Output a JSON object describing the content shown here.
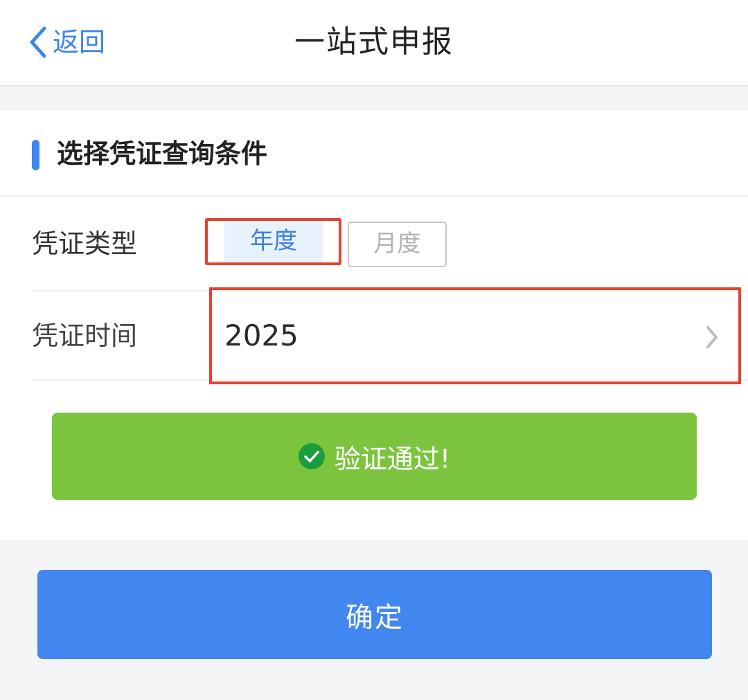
{
  "navbar": {
    "back_label": "返回",
    "title": "一站式申报"
  },
  "section": {
    "title": "选择凭证查询条件"
  },
  "form": {
    "type_label": "凭证类型",
    "type_options": [
      {
        "label": "年度",
        "selected": true
      },
      {
        "label": "月度",
        "selected": false
      }
    ],
    "time_label": "凭证时间",
    "time_value": "2025"
  },
  "verification": {
    "message": "验证通过!",
    "icon": "check-circle-icon"
  },
  "confirm": {
    "label": "确定"
  },
  "colors": {
    "accent": "#4287ef",
    "success": "#7cc43e",
    "highlight_outline": "#e0442f"
  }
}
